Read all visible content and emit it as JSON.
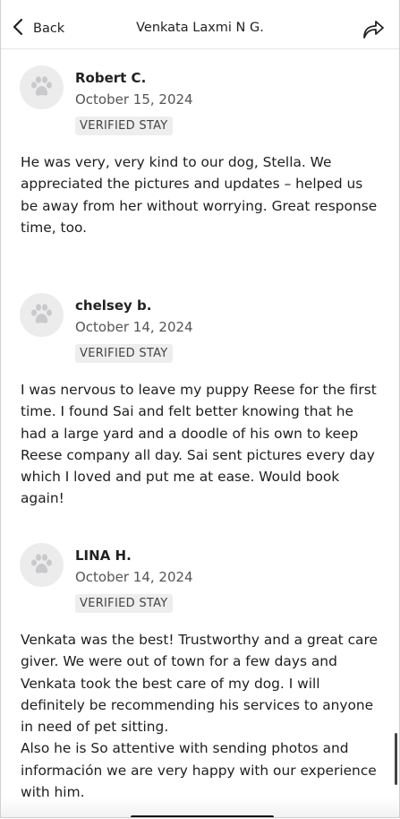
{
  "header": {
    "back_label": "Back",
    "title": "Venkata Laxmi N G."
  },
  "reviews": [
    {
      "name": "Robert C.",
      "date": "October 15, 2024",
      "badge": "VERIFIED STAY",
      "text": "He was very, very kind to our dog, Stella. We appreciated the pictures and updates – helped us be away from her without worrying. Great response time, too."
    },
    {
      "name": "chelsey b.",
      "date": "October 14, 2024",
      "badge": "VERIFIED STAY",
      "text": "I was nervous to leave my puppy Reese for the first time. I found Sai and felt better knowing that he had a large yard and a doodle of his own to keep Reese company all day. Sai sent pictures every day which I loved and put me at ease. Would book again!"
    },
    {
      "name": "LINA H.",
      "date": "October 14, 2024",
      "badge": "VERIFIED STAY",
      "text": "Venkata was the best! Trustworthy and a great care giver. We were out of town for a few days and Venkata took the best care of my dog. I will definitely be recommending his services to anyone in need of pet sitting.\nAlso he is So attentive with sending photos and información we are very happy with our experience with him."
    }
  ],
  "icons": {
    "back": "chevron-left-icon",
    "share": "share-arrow-icon",
    "avatar": "paw-icon"
  },
  "colors": {
    "avatar_bg": "#ececed",
    "badge_bg": "#eeeeef",
    "paw": "#c9c9cb"
  }
}
